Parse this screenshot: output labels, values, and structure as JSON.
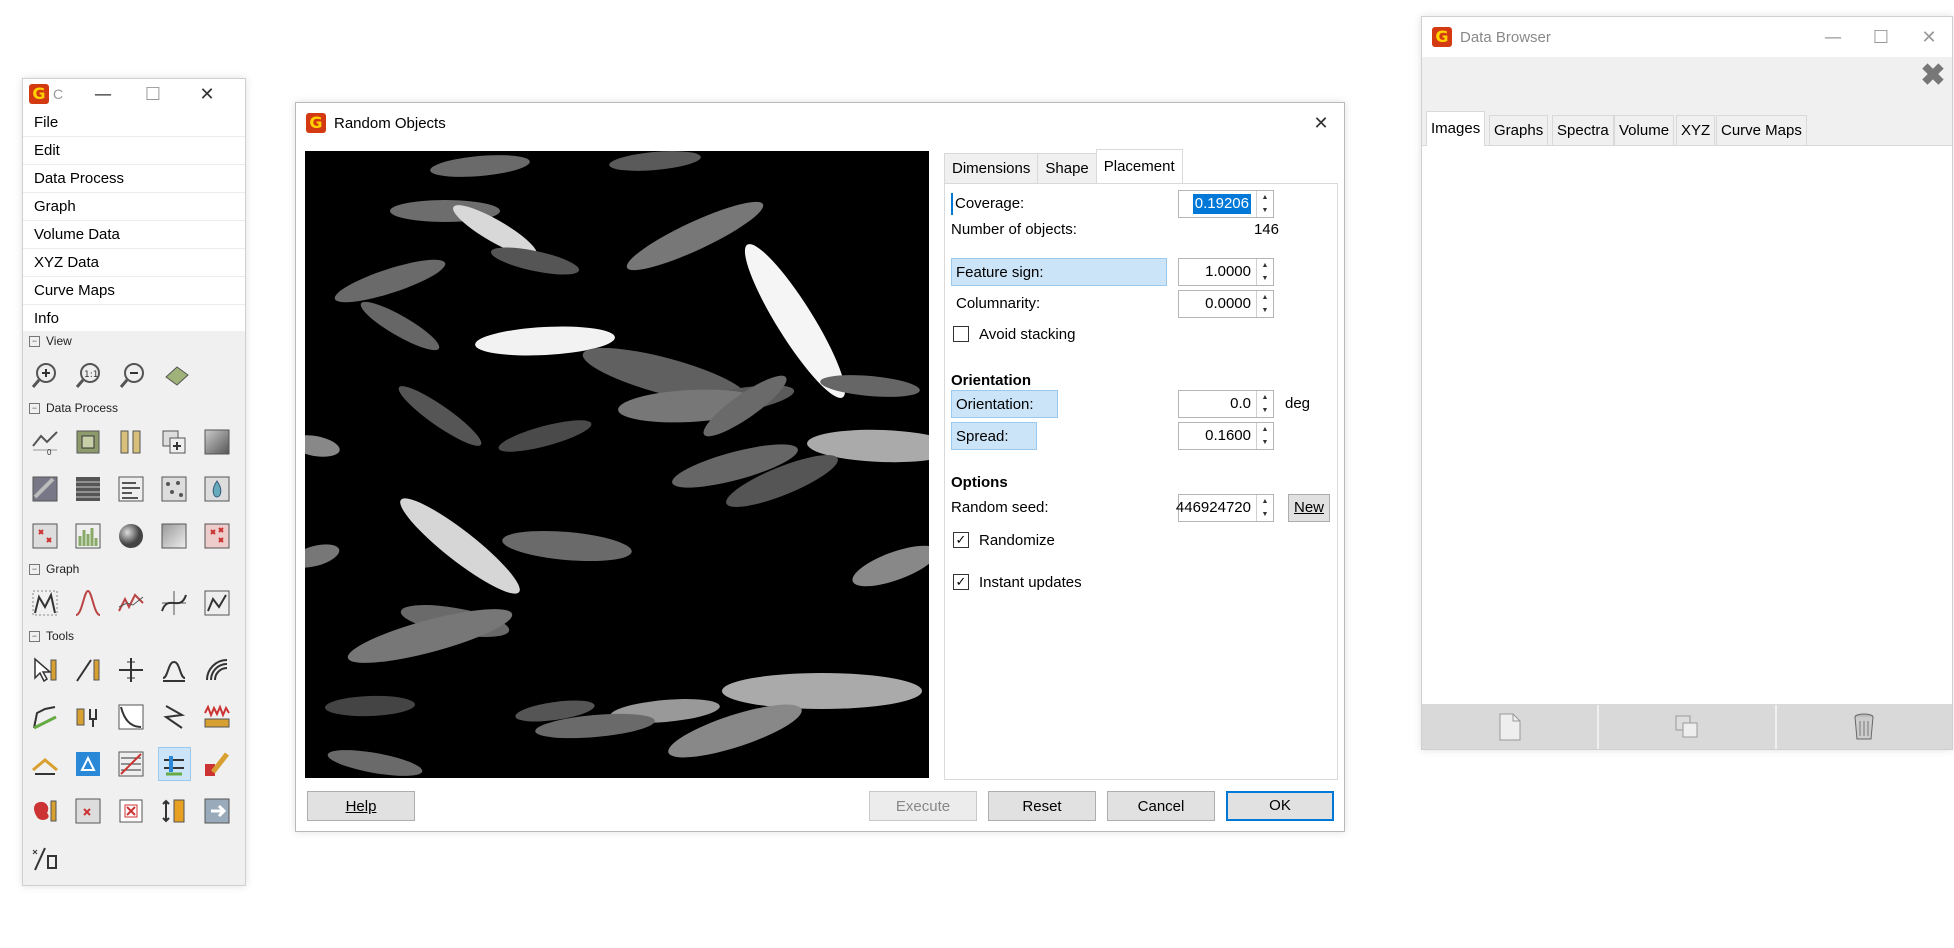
{
  "main_window": {
    "title": "C",
    "menu": [
      "File",
      "Edit",
      "Data Process",
      "Graph",
      "Volume Data",
      "XYZ Data",
      "Curve Maps",
      "Info"
    ],
    "sections": {
      "view": "View",
      "data_process": "Data Process",
      "graph": "Graph",
      "tools": "Tools"
    }
  },
  "dialog": {
    "title": "Random Objects",
    "tabs": [
      "Dimensions",
      "Shape",
      "Placement"
    ],
    "active_tab": "Placement",
    "coverage_label": "Coverage:",
    "coverage_value": "0.19206",
    "num_objects_label": "Number of objects:",
    "num_objects_value": "146",
    "feature_sign_label": "Feature sign:",
    "feature_sign_value": "1.0000",
    "columnarity_label": "Columnarity:",
    "columnarity_value": "0.0000",
    "avoid_stacking_label": "Avoid stacking",
    "avoid_stacking_checked": false,
    "orientation_heading": "Orientation",
    "orientation_label": "Orientation:",
    "orientation_value": "0.0",
    "orientation_unit": "deg",
    "spread_label": "Spread:",
    "spread_value": "0.1600",
    "options_heading": "Options",
    "seed_label": "Random seed:",
    "seed_value": "446924720",
    "new_button": "New",
    "randomize_label": "Randomize",
    "randomize_checked": true,
    "instant_label": "Instant updates",
    "instant_checked": true,
    "buttons": {
      "help": "Help",
      "execute": "Execute",
      "reset": "Reset",
      "cancel": "Cancel",
      "ok": "OK"
    }
  },
  "data_browser": {
    "title": "Data Browser",
    "tabs": [
      "Images",
      "Graphs",
      "Spectra",
      "Volume",
      "XYZ",
      "Curve Maps"
    ],
    "active_tab": "Images"
  }
}
